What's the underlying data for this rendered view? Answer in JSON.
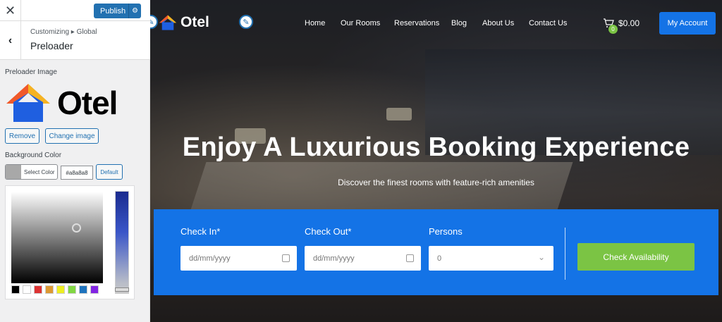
{
  "customizer": {
    "close_icon": "close-icon",
    "publish_label": "Publish",
    "breadcrumb": "Customizing ▸ Global",
    "section_title": "Preloader",
    "preloader_image_label": "Preloader Image",
    "logo_text": "Otel",
    "remove_label": "Remove",
    "change_image_label": "Change image",
    "background_color_label": "Background Color",
    "select_color_label": "Select Color",
    "hex_value": "#a8a8a8",
    "default_label": "Default",
    "palette": [
      "#000000",
      "#ffffff",
      "#dd3333",
      "#dd9933",
      "#eeee22",
      "#81d742",
      "#1e73be",
      "#8224e3"
    ]
  },
  "site": {
    "logo_text": "Otel",
    "nav": [
      "Home",
      "Our Rooms",
      "Reservations",
      "Blog",
      "About Us",
      "Contact Us"
    ],
    "cart_count": "0",
    "cart_total": "$0.00",
    "account_label": "My Account",
    "hero_title": "Enjoy A Luxurious Booking Experience",
    "hero_subtitle": "Discover the finest rooms with feature-rich amenities",
    "booking": {
      "check_in_label": "Check In*",
      "check_in_placeholder": "dd/mm/yyyy",
      "check_out_label": "Check Out*",
      "check_out_placeholder": "dd/mm/yyyy",
      "persons_label": "Persons",
      "persons_value": "0",
      "button_label": "Check Availability"
    }
  }
}
